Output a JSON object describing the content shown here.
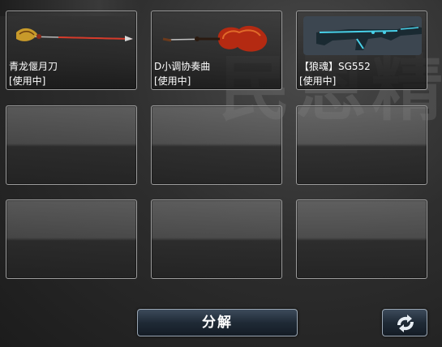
{
  "background": {
    "watermark_text": "民恩精"
  },
  "inventory": {
    "slots": [
      {
        "name": "青龙偃月刀",
        "status": "[使用中]",
        "icon": "crescent-blade-icon"
      },
      {
        "name": "D小调协奏曲",
        "status": "[使用中]",
        "icon": "violin-icon"
      },
      {
        "name": "【狼魂】SG552",
        "status": "[使用中]",
        "icon": "rifle-icon"
      },
      {
        "name": "",
        "status": ""
      },
      {
        "name": "",
        "status": ""
      },
      {
        "name": "",
        "status": ""
      },
      {
        "name": "",
        "status": ""
      },
      {
        "name": "",
        "status": ""
      },
      {
        "name": "",
        "status": ""
      }
    ]
  },
  "actions": {
    "decompose_label": "分解",
    "refresh_icon": "refresh-arrows-icon"
  },
  "colors": {
    "button_border": "#9aa6b3",
    "slot_border": "#9c9c9c",
    "text": "#ffffff"
  }
}
